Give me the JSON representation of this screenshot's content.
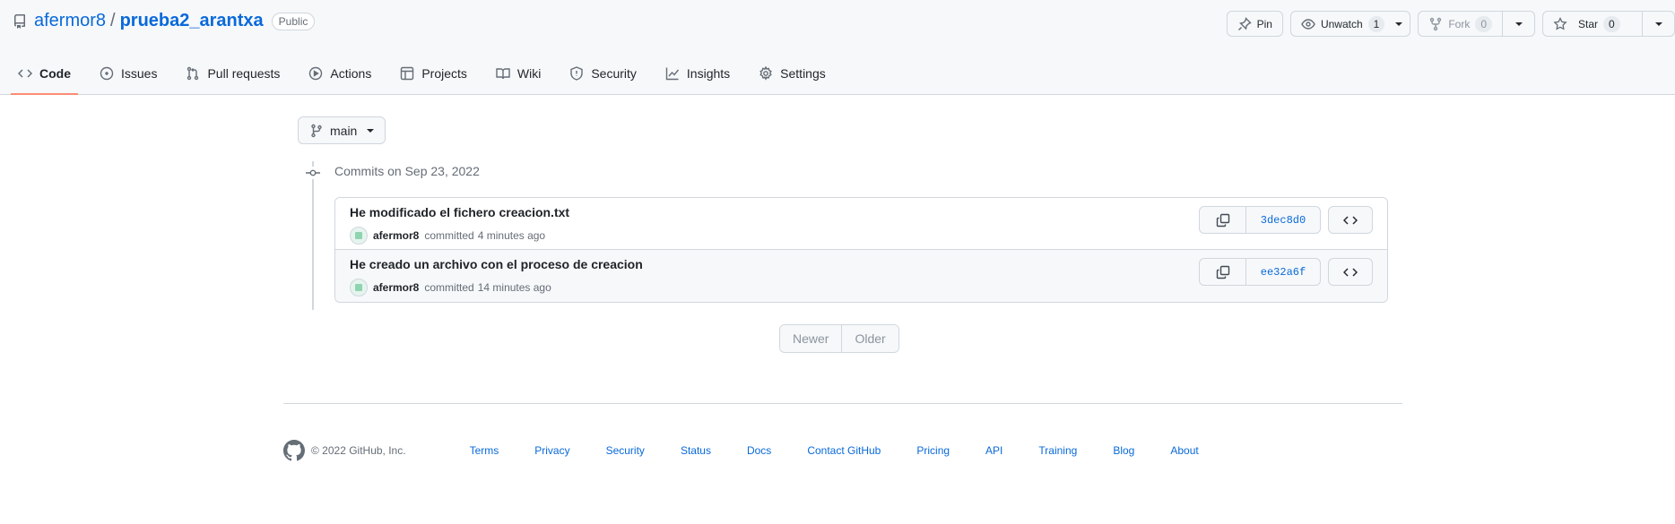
{
  "repo": {
    "owner": "afermor8",
    "separator": "/",
    "name": "prueba2_arantxa",
    "visibility": "Public"
  },
  "actions": {
    "pin": "Pin",
    "unwatch": "Unwatch",
    "unwatch_count": "1",
    "fork": "Fork",
    "fork_count": "0",
    "star": "Star",
    "star_count": "0"
  },
  "tabs": [
    {
      "label": "Code",
      "icon": "code-icon",
      "selected": true
    },
    {
      "label": "Issues",
      "icon": "issue-opened-icon"
    },
    {
      "label": "Pull requests",
      "icon": "git-pull-request-icon"
    },
    {
      "label": "Actions",
      "icon": "play-icon"
    },
    {
      "label": "Projects",
      "icon": "table-icon"
    },
    {
      "label": "Wiki",
      "icon": "book-icon"
    },
    {
      "label": "Security",
      "icon": "shield-icon"
    },
    {
      "label": "Insights",
      "icon": "graph-icon"
    },
    {
      "label": "Settings",
      "icon": "gear-icon"
    }
  ],
  "branch": "main",
  "commits_heading": "Commits on Sep 23, 2022",
  "commits": [
    {
      "message": "He modificado el fichero creacion.txt",
      "author": "afermor8",
      "verb": "committed",
      "time": "4 minutes ago",
      "sha": "3dec8d0"
    },
    {
      "message": "He creado un archivo con el proceso de creacion",
      "author": "afermor8",
      "verb": "committed",
      "time": "14 minutes ago",
      "sha": "ee32a6f"
    }
  ],
  "pagination": {
    "newer": "Newer",
    "older": "Older"
  },
  "footer": {
    "copyright": "© 2022 GitHub, Inc.",
    "links": [
      "Terms",
      "Privacy",
      "Security",
      "Status",
      "Docs",
      "Contact GitHub",
      "Pricing",
      "API",
      "Training",
      "Blog",
      "About"
    ]
  },
  "colors": {
    "link": "#0969da",
    "selected_tab_underline": "#fd8c73",
    "border": "#d0d7de",
    "muted_text": "#656d76"
  }
}
